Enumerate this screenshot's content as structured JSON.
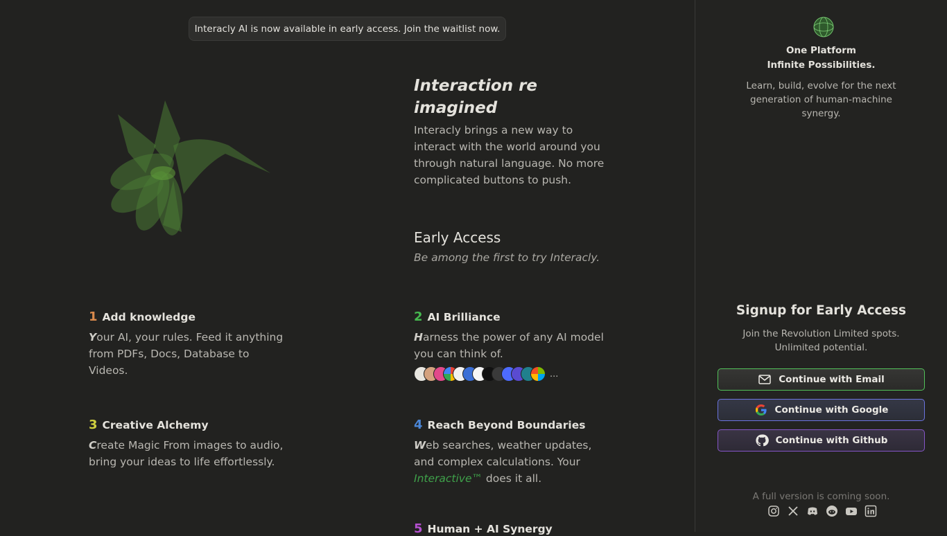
{
  "banner": {
    "text": "Interacly AI is now available in early access. Join the waitlist now."
  },
  "hero": {
    "title": "Interaction re imagined",
    "description": "Interacly brings a new way to interact with the world around you through natural language. No more complicated buttons to push."
  },
  "early_access": {
    "title": "Early Access",
    "subtitle": "Be among the first to try Interacly."
  },
  "features": [
    {
      "num": "1",
      "title": "Add knowledge",
      "cap": "Y",
      "desc": "our AI, your rules. Feed it anything from PDFs, Docs, Database to Videos.",
      "color": "#d98a4c"
    },
    {
      "num": "2",
      "title": "AI Brilliance",
      "cap": "H",
      "desc": "arness the power of any AI model you can think of.",
      "color": "#46b94f"
    },
    {
      "num": "3",
      "title": "Creative Alchemy",
      "cap": "C",
      "desc": "reate Magic From images to audio, bring your ideas to life effortlessly.",
      "color": "#cfcf3f"
    },
    {
      "num": "4",
      "title": "Reach Beyond Boundaries",
      "cap": "W",
      "desc": "eb searches, weather updates, and complex calculations. Your ",
      "brand": "Interactive™",
      "desc_end": " does it all.",
      "color": "#4b86d6"
    },
    {
      "num": "5",
      "title": "Human + AI Synergy",
      "color": "#b550d0"
    }
  ],
  "models": {
    "more": "...",
    "icons": [
      "openai-icon",
      "anthropic-icon",
      "model-pink-icon",
      "google-icon",
      "meta-icon",
      "model-blue-icon",
      "x-icon",
      "nvidia-icon",
      "stability-icon",
      "deepseek-icon",
      "model-purple-icon",
      "perplexity-icon",
      "microsoft-icon"
    ]
  },
  "sidebar": {
    "tagline1": "One Platform",
    "tagline2": "Infinite Possibilities.",
    "description": "Learn, build, evolve for the next generation of human-machine synergy.",
    "signup_title": "Signup for Early Access",
    "signup_desc": "Join the Revolution Limited spots. Unlimited potential.",
    "email_btn": "Continue with Email",
    "google_btn": "Continue with Google",
    "github_btn": "Continue with Github",
    "footer_note": "A full version is coming soon.",
    "socials": [
      "instagram-icon",
      "x-icon",
      "discord-icon",
      "reddit-icon",
      "youtube-icon",
      "linkedin-icon"
    ]
  },
  "colors": {
    "accent_green": "#46b94f",
    "email_border": "#52c35a",
    "google_border": "#6b74e0",
    "github_border": "#8656c9"
  }
}
